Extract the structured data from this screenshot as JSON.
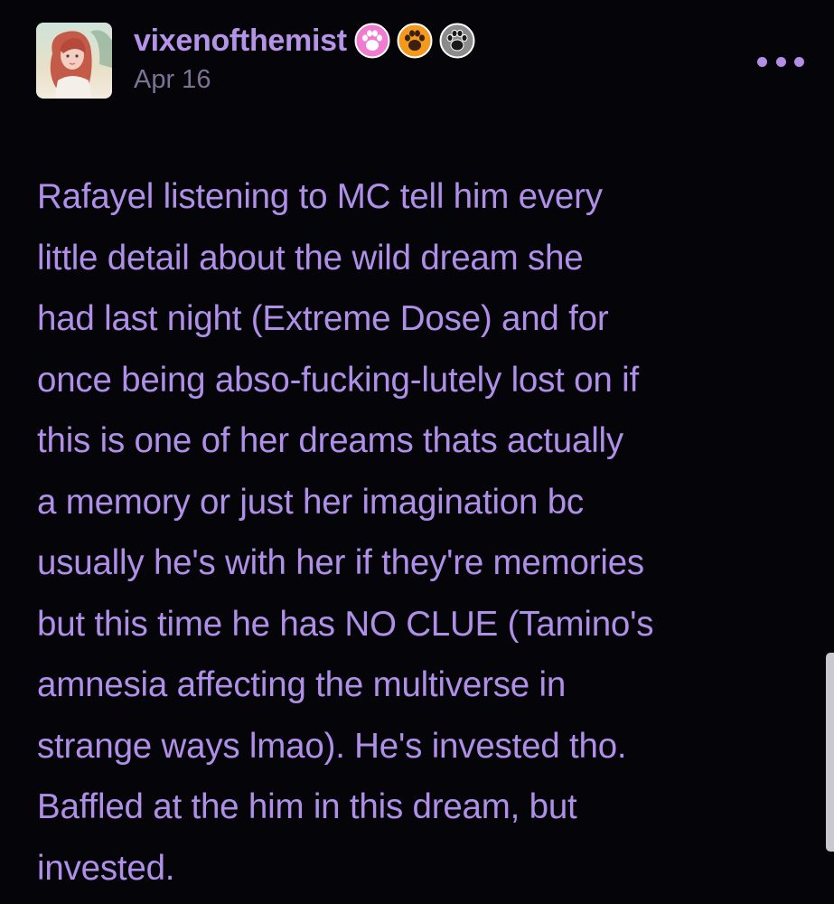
{
  "post": {
    "username": "vixenofthemist",
    "date": "Apr 16",
    "avatar_icon": "avatar-image",
    "badges": [
      {
        "icon": "paw-badge-pink",
        "color": "#f07bd0"
      },
      {
        "icon": "paw-badge-orange",
        "color": "#f39a1e"
      },
      {
        "icon": "paw-badge-gray",
        "color": "#8b8b8b"
      }
    ],
    "more_icon": "more-options-icon",
    "body_lines": [
      "Rafayel listening to MC tell him every",
      "little detail about the wild dream she",
      "had last night (Extreme Dose) and for",
      "once being abso-fucking-lutely lost on if",
      "this is one of her dreams thats actually",
      "a memory or just her imagination bc",
      "usually he's with her if they're memories",
      "but this time he has NO CLUE (Tamino's",
      "amnesia affecting the multiverse in",
      "strange ways lmao). He's invested tho.",
      "Baffled at the him in this dream, but",
      "invested."
    ]
  },
  "colors": {
    "background": "#050408",
    "accent": "#b594e8",
    "body_text": "#b08fe9",
    "muted": "#7d7293"
  }
}
